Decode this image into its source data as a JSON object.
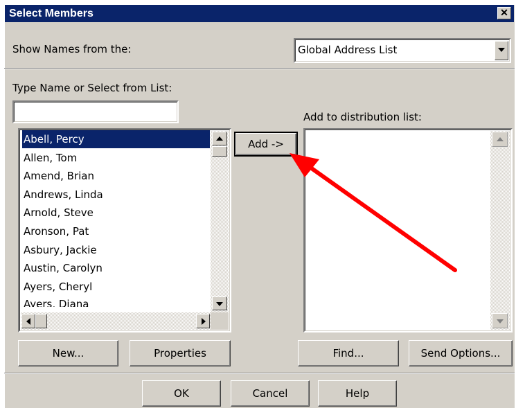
{
  "dialog": {
    "title": "Select Members",
    "close_glyph": "✕"
  },
  "source": {
    "label": "Show Names from the:",
    "selected": "Global Address List"
  },
  "search": {
    "label": "Type Name or Select from List:",
    "value": ""
  },
  "names": [
    "Abell, Percy",
    "Allen, Tom",
    "Amend, Brian",
    "Andrews, Linda",
    "Arnold, Steve",
    "Aronson, Pat",
    "Asbury, Jackie",
    "Austin, Carolyn",
    "Ayers, Cheryl",
    "Ayers, Diana"
  ],
  "add_button": "Add ->",
  "target_list": {
    "label": "Add to distribution list:"
  },
  "buttons": {
    "new": "New...",
    "properties": "Properties",
    "find": "Find...",
    "send_options": "Send Options...",
    "ok": "OK",
    "cancel": "Cancel",
    "help": "Help"
  },
  "annotation": {
    "color": "#ff0000",
    "icon": "arrow-annotation-icon"
  },
  "colors": {
    "titlebar": "#0a246a",
    "face": "#d4d0c8",
    "selection": "#0a246a"
  }
}
